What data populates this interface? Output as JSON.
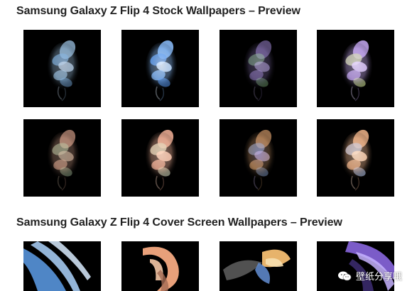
{
  "sections": [
    {
      "title": "Samsung Galaxy Z Flip 4 Stock Wallpapers – Preview",
      "thumbnails": [
        {
          "palette": [
            "#9fc6e8",
            "#6fa3d6",
            "#c8d9ef"
          ],
          "bright": 0.85
        },
        {
          "palette": [
            "#8cc0ff",
            "#4f8ee6",
            "#e5f1ff"
          ],
          "bright": 1.0
        },
        {
          "palette": [
            "#a98fe0",
            "#8fcf8a",
            "#c9b6f0"
          ],
          "bright": 0.6
        },
        {
          "palette": [
            "#c6a8f2",
            "#cfe58f",
            "#e9d9ff"
          ],
          "bright": 1.0
        },
        {
          "palette": [
            "#f0b49a",
            "#a9c7a2",
            "#d7c0a8"
          ],
          "bright": 0.7
        },
        {
          "palette": [
            "#f4b399",
            "#d6e0c2",
            "#ffd8c2"
          ],
          "bright": 1.0
        },
        {
          "palette": [
            "#e1a570",
            "#8aa9dd",
            "#c5b3e8"
          ],
          "bright": 0.75
        },
        {
          "palette": [
            "#f0b48a",
            "#b4c8f0",
            "#ffe0c8"
          ],
          "bright": 1.0
        }
      ]
    },
    {
      "title": "Samsung Galaxy Z Flip 4 Cover Screen Wallpapers – Preview",
      "thumbnails": [
        {
          "palette": [
            "#4f86c6",
            "#a3c8ee",
            "#d9ecff"
          ]
        },
        {
          "palette": [
            "#e8a07a",
            "#f4c7a6",
            "#a46b55"
          ]
        },
        {
          "palette": [
            "#e7b36b",
            "#5d86c8",
            "#f6dfb0"
          ]
        },
        {
          "palette": [
            "#7b5cc8",
            "#c7b3ff",
            "#3a2a6b"
          ]
        }
      ]
    }
  ],
  "watermark": {
    "text": "壁纸分享哦",
    "icon": "wechat-icon"
  }
}
